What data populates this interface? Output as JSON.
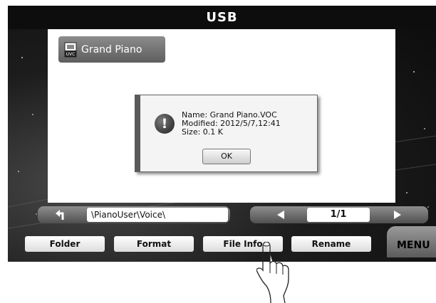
{
  "window": {
    "title": "USB"
  },
  "file_list": {
    "items": [
      {
        "label": "Grand Piano",
        "icon": "uvc-voice-file-icon"
      }
    ]
  },
  "dialog": {
    "icon": "warning-icon",
    "icon_glyph": "!",
    "name_line": "Name: Grand Piano.VOC",
    "modified_line": "Modified: 2012/5/7,12:41",
    "size_line": "Size: 0.1 K",
    "ok_label": "OK"
  },
  "path_bar": {
    "back_icon": "back-arrow-icon",
    "path": "\\PianoUser\\Voice\\"
  },
  "pager": {
    "page": "1/1",
    "prev_icon": "triangle-left-icon",
    "next_icon": "triangle-right-icon"
  },
  "softkeys": {
    "folder": "Folder",
    "format": "Format",
    "file_info": "File Info",
    "rename": "Rename",
    "menu": "MENU"
  },
  "colors": {
    "background": "#0b0b0b",
    "panel": "#ffffff",
    "titlebar": "#0d0d0d"
  }
}
